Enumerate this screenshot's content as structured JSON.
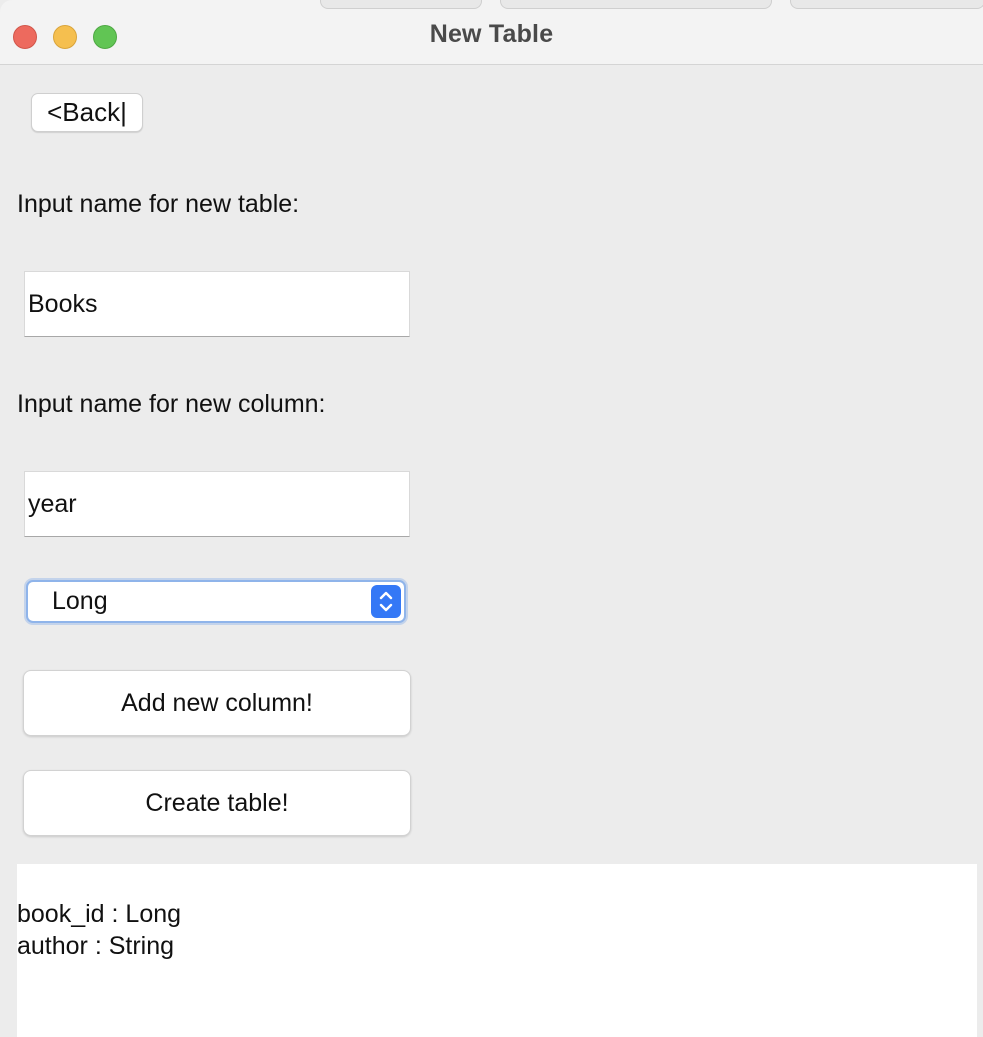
{
  "window": {
    "title": "New Table"
  },
  "toolbar": {
    "back_label": "<Back|"
  },
  "form": {
    "table_name_label": "Input name for new table:",
    "table_name_value": "Books",
    "column_name_label": "Input name for new column:",
    "column_name_value": "year",
    "column_type": {
      "selected": "Long",
      "icon": "chevron-up-down-icon"
    },
    "add_column_label": "Add new column!",
    "create_table_label": "Create table!"
  },
  "columns": [
    "book_id : Long",
    "author : String"
  ],
  "colors": {
    "accent": "#3478f6",
    "close": "#ed6a5e",
    "minimize": "#f5bf4f",
    "maximize": "#61c554"
  }
}
